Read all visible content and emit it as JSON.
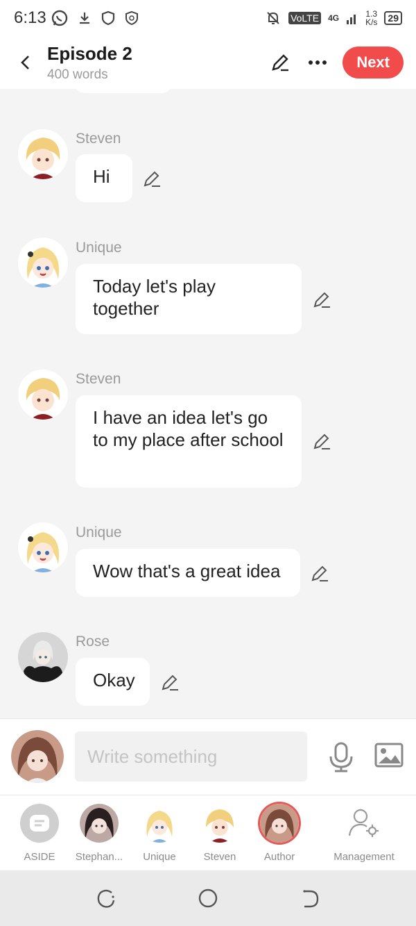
{
  "status": {
    "time": "6:13",
    "volte": "VoLTE",
    "network": "4G",
    "speed_value": "1.3",
    "speed_unit": "K/s",
    "battery": "29"
  },
  "header": {
    "title": "Episode 2",
    "subtitle": "400 words",
    "next_label": "Next"
  },
  "messages": [
    {
      "sender": "Steven",
      "text": "Hi"
    },
    {
      "sender": "Unique",
      "text": "Today let's play together"
    },
    {
      "sender": "Steven",
      "text": "I have an idea let's go to my place after school"
    },
    {
      "sender": "Unique",
      "text": "Wow that's a great idea"
    },
    {
      "sender": "Rose",
      "text": "Okay"
    }
  ],
  "composer": {
    "placeholder": "Write something"
  },
  "roles": [
    {
      "label": "ASIDE"
    },
    {
      "label": "Stephan..."
    },
    {
      "label": "Unique"
    },
    {
      "label": "Steven"
    },
    {
      "label": "Author",
      "selected": true
    },
    {
      "label": "Management"
    }
  ],
  "colors": {
    "accent": "#f24b4b",
    "background": "#f4f4f4",
    "bubble": "#ffffff"
  },
  "icons": [
    "back-arrow-icon",
    "edit-pencil-icon",
    "more-icon",
    "microphone-icon",
    "image-icon",
    "management-icon",
    "recent-apps-icon",
    "home-icon",
    "back-nav-icon"
  ]
}
